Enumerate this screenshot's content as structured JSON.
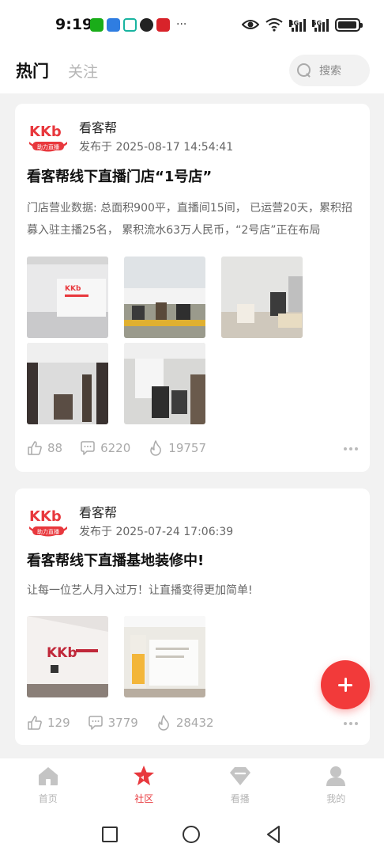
{
  "status_bar": {
    "time": "9:19",
    "signal_1": "4G",
    "signal_2": "5G",
    "battery_level": 0.95
  },
  "header": {
    "tab_hot": "热门",
    "tab_follow": "关注",
    "search_placeholder": "搜索"
  },
  "posts": [
    {
      "logo_text": "KKb",
      "logo_sub": "助力直播",
      "author": "看客帮",
      "published": "发布于 2025-08-17 14:54:41",
      "title": "看客帮线下直播门店“1号店”",
      "body": "门店营业数据: 总面积900平，直播间15间， 已运营20天，累积招募入驻主播25名， 累积流水63万人民币，“2号店”正在布局",
      "likes": "88",
      "comments": "6220",
      "views": "19757"
    },
    {
      "logo_text": "KKb",
      "logo_sub": "助力直播",
      "author": "看客帮",
      "published": "发布于 2025-07-24 17:06:39",
      "title": "看客帮线下直播基地装修中!",
      "body": "让每一位艺人月入过万！让直播变得更加简单!",
      "likes": "129",
      "comments": "3779",
      "views": "28432"
    }
  ],
  "bottom_nav": {
    "home": "首页",
    "community": "社区",
    "watch": "看播",
    "mine": "我的"
  },
  "colors": {
    "accent": "#e8383d",
    "fab": "#f23a3a"
  }
}
